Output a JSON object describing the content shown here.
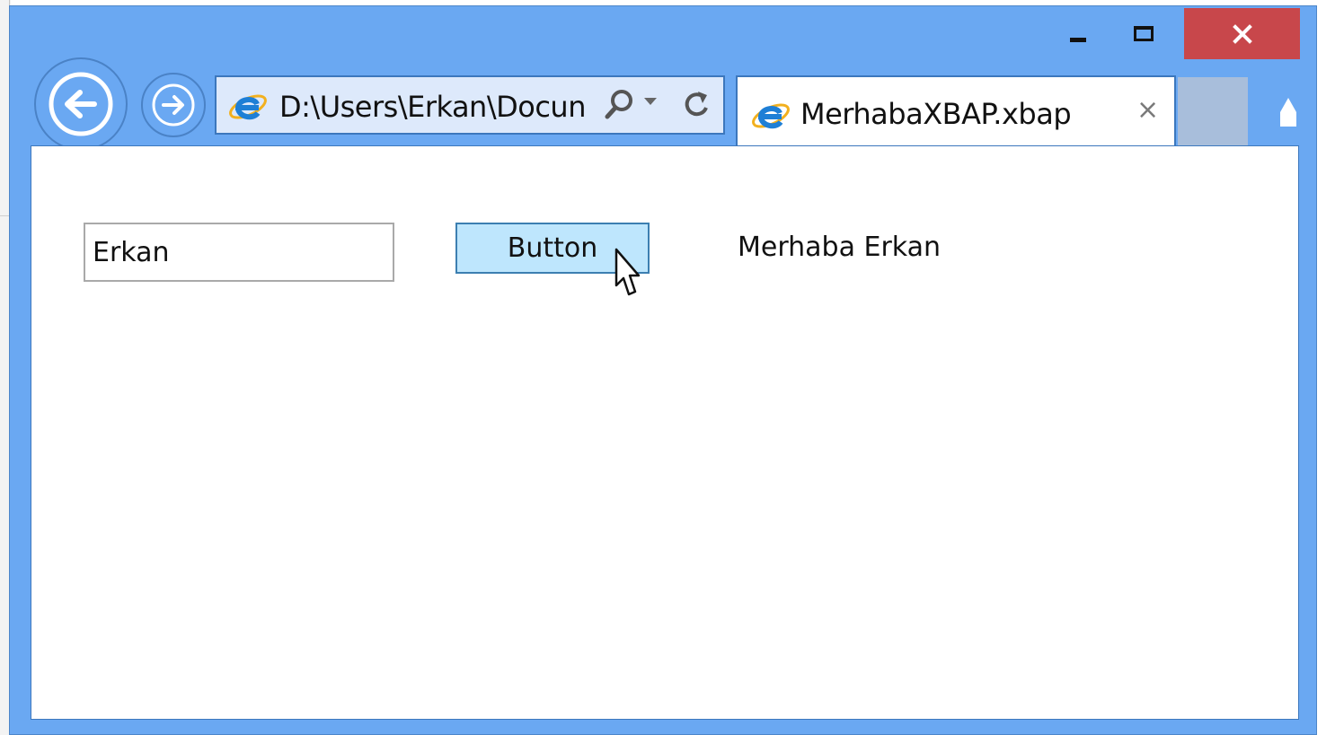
{
  "browser": {
    "address": "D:\\Users\\Erkan\\Docun",
    "tab_title": "MerhabaXBAP.xbap",
    "tab_close": "×",
    "caption": {
      "close_symbol": "×"
    }
  },
  "app": {
    "textbox_value": "Erkan",
    "button_label": "Button",
    "greeting": "Merhaba Erkan"
  },
  "colors": {
    "frame": "#6aa8f2",
    "close_button": "#c8474b",
    "button_face": "#bee6fd",
    "new_tab": "#a8bedb"
  },
  "icons": [
    "back-arrow-icon",
    "forward-arrow-icon",
    "ie-logo-icon",
    "search-icon",
    "dropdown-chevron-icon",
    "refresh-icon",
    "home-icon",
    "mouse-cursor-icon"
  ]
}
